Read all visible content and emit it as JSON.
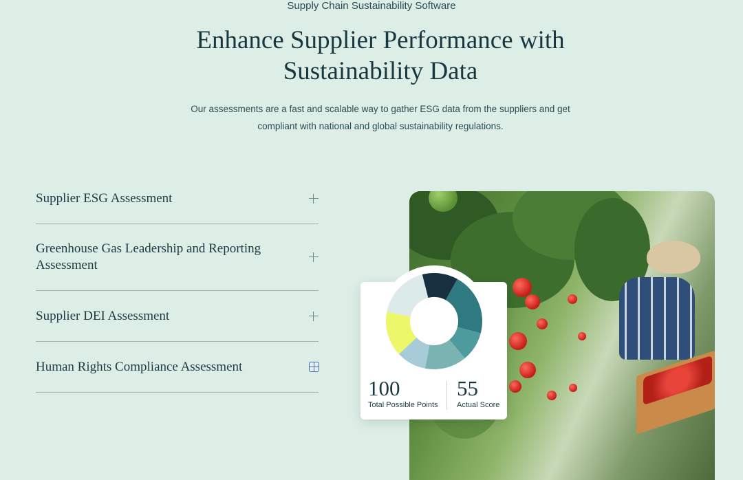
{
  "header": {
    "eyebrow": "Supply Chain Sustainability Software",
    "headline": "Enhance Supplier Performance with Sustainability Data",
    "subtext": "Our assessments are a fast and scalable way to gather ESG data from the suppliers and get compliant with national and global sustainability regulations."
  },
  "accordion": {
    "items": [
      {
        "label": "Supplier ESG Assessment",
        "icon": "plus-icon"
      },
      {
        "label": "Greenhouse Gas Leadership and Reporting Assessment",
        "icon": "plus-icon"
      },
      {
        "label": "Supplier DEI Assessment",
        "icon": "plus-icon"
      },
      {
        "label": "Human Rights Compliance Assessment",
        "icon": "grid-plus-icon"
      }
    ]
  },
  "score_card": {
    "total_value": "100",
    "total_label": "Total Possible Points",
    "actual_value": "55",
    "actual_label": "Actual Score",
    "segments": [
      {
        "color": "#17303f",
        "fraction": 0.12
      },
      {
        "color": "#2f7a80",
        "fraction": 0.21
      },
      {
        "color": "#4e9b9e",
        "fraction": 0.1
      },
      {
        "color": "#7bb3b3",
        "fraction": 0.14
      },
      {
        "color": "#a8cbd9",
        "fraction": 0.1
      },
      {
        "color": "#ecf76a",
        "fraction": 0.15
      },
      {
        "color": "#dcebe9",
        "fraction": 0.18
      }
    ]
  },
  "photo": {
    "description_icon": "farmer-tomato-photo"
  }
}
